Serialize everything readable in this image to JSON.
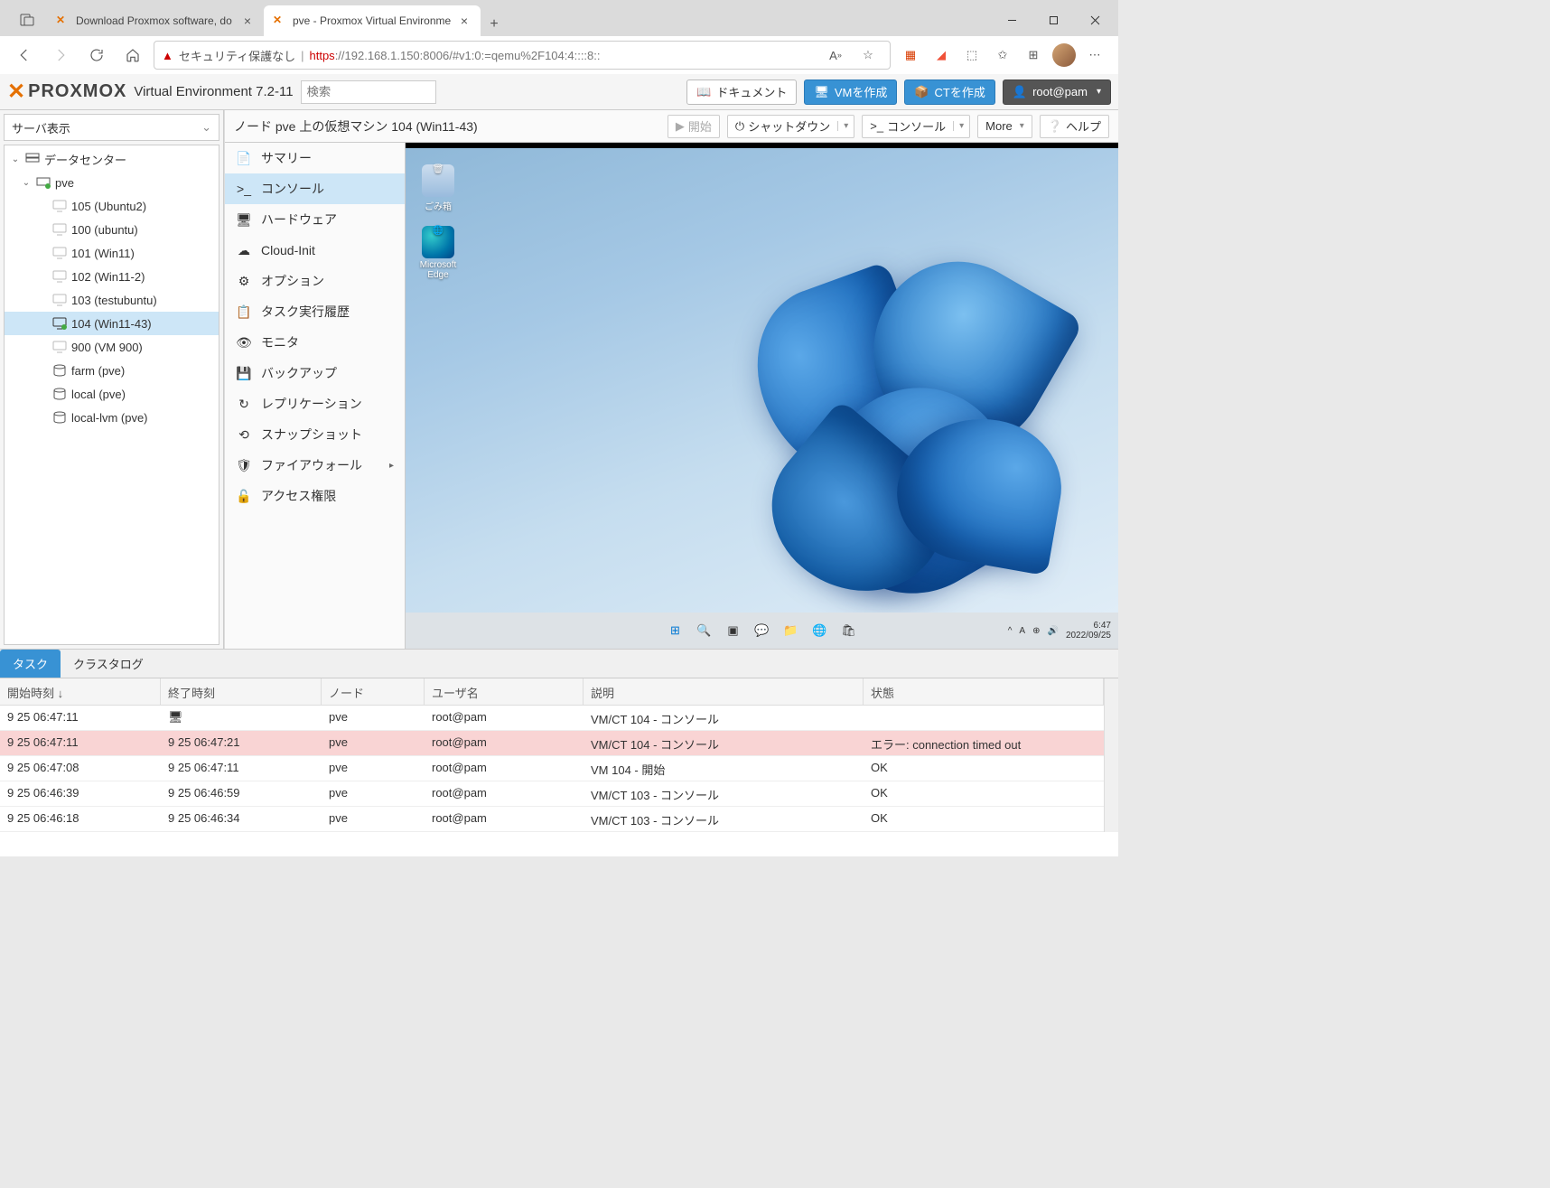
{
  "browser": {
    "tabs": [
      {
        "title": "Download Proxmox software, do",
        "active": false
      },
      {
        "title": "pve - Proxmox Virtual Environme",
        "active": true
      }
    ],
    "security_text": "セキュリティ保護なし",
    "url_scheme": "https",
    "url_host": "://192.168.1.150",
    "url_port_path": ":8006/#v1:0:=qemu%2F104:4::::8::"
  },
  "header": {
    "logo_text": "PROXMOX",
    "version": "Virtual Environment 7.2-11",
    "search_placeholder": "検索",
    "btn_docs": "ドキュメント",
    "btn_vm": "VMを作成",
    "btn_ct": "CTを作成",
    "user": "root@pam"
  },
  "sidebar": {
    "view_label": "サーバ表示",
    "tree": {
      "datacenter": "データセンター",
      "node": "pve",
      "vms": [
        {
          "id": "105",
          "label": "105 (Ubuntu2)",
          "running": false
        },
        {
          "id": "100",
          "label": "100 (ubuntu)",
          "running": false
        },
        {
          "id": "101",
          "label": "101 (Win11)",
          "running": false
        },
        {
          "id": "102",
          "label": "102 (Win11-2)",
          "running": false
        },
        {
          "id": "103",
          "label": "103 (testubuntu)",
          "running": false
        },
        {
          "id": "104",
          "label": "104 (Win11-43)",
          "running": true,
          "selected": true
        },
        {
          "id": "900",
          "label": "900 (VM 900)",
          "running": false
        }
      ],
      "storage": [
        {
          "label": "farm (pve)"
        },
        {
          "label": "local (pve)"
        },
        {
          "label": "local-lvm (pve)"
        }
      ]
    }
  },
  "content": {
    "title": "ノード pve 上の仮想マシン 104 (Win11-43)",
    "btn_start": "開始",
    "btn_shutdown": "シャットダウン",
    "btn_console": "コンソール",
    "btn_more": "More",
    "btn_help": "ヘルプ",
    "menu": [
      {
        "key": "summary",
        "label": "サマリー",
        "icon": "📄"
      },
      {
        "key": "console",
        "label": "コンソール",
        "icon": ">_",
        "active": true
      },
      {
        "key": "hardware",
        "label": "ハードウェア",
        "icon": "🖥"
      },
      {
        "key": "cloudinit",
        "label": "Cloud-Init",
        "icon": "☁"
      },
      {
        "key": "options",
        "label": "オプション",
        "icon": "⚙"
      },
      {
        "key": "taskhistory",
        "label": "タスク実行履歴",
        "icon": "📋"
      },
      {
        "key": "monitor",
        "label": "モニタ",
        "icon": "👁"
      },
      {
        "key": "backup",
        "label": "バックアップ",
        "icon": "💾"
      },
      {
        "key": "replication",
        "label": "レプリケーション",
        "icon": "↻"
      },
      {
        "key": "snapshot",
        "label": "スナップショット",
        "icon": "⟲"
      },
      {
        "key": "firewall",
        "label": "ファイアウォール",
        "icon": "🛡",
        "sub": true
      },
      {
        "key": "permission",
        "label": "アクセス権限",
        "icon": "🔓"
      }
    ],
    "desktop": {
      "icon1": "ごみ箱",
      "icon2": "Microsoft Edge",
      "taskbar_time": "6:47",
      "taskbar_date": "2022/09/25"
    }
  },
  "tasks": {
    "tab_tasks": "タスク",
    "tab_cluster": "クラスタログ",
    "columns": {
      "start": "開始時刻 ↓",
      "end": "終了時刻",
      "node": "ノード",
      "user": "ユーザ名",
      "desc": "説明",
      "status": "状態"
    },
    "rows": [
      {
        "start": "9 25 06:47:11",
        "end": "",
        "end_icon": true,
        "node": "pve",
        "user": "root@pam",
        "desc": "VM/CT 104 - コンソール",
        "status": ""
      },
      {
        "start": "9 25 06:47:11",
        "end": "9 25 06:47:21",
        "node": "pve",
        "user": "root@pam",
        "desc": "VM/CT 104 - コンソール",
        "status": "エラー: connection timed out",
        "error": true
      },
      {
        "start": "9 25 06:47:08",
        "end": "9 25 06:47:11",
        "node": "pve",
        "user": "root@pam",
        "desc": "VM 104 - 開始",
        "status": "OK"
      },
      {
        "start": "9 25 06:46:39",
        "end": "9 25 06:46:59",
        "node": "pve",
        "user": "root@pam",
        "desc": "VM/CT 103 - コンソール",
        "status": "OK"
      },
      {
        "start": "9 25 06:46:18",
        "end": "9 25 06:46:34",
        "node": "pve",
        "user": "root@pam",
        "desc": "VM/CT 103 - コンソール",
        "status": "OK"
      }
    ]
  }
}
